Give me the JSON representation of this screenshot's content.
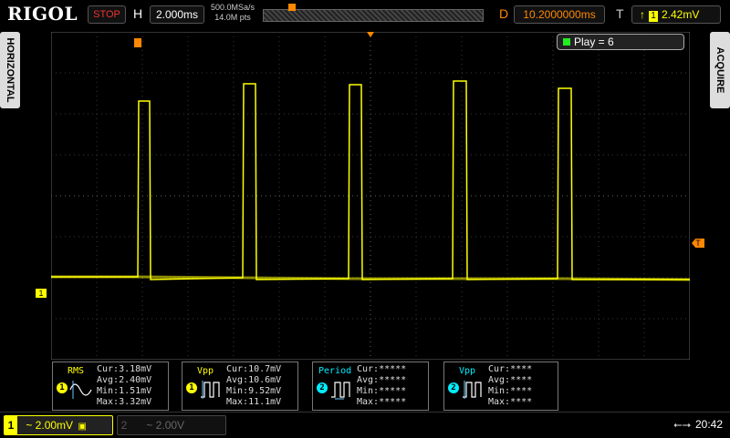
{
  "header": {
    "logo": "RIGOL",
    "run_state": "STOP",
    "horizontal_label": "H",
    "timebase": "2.000ms",
    "sample_rate": "500.0MSa/s",
    "memory_depth": "14.0M pts",
    "delay_label": "D",
    "delay": "10.2000000ms",
    "trigger_label": "T",
    "trigger_channel": "1",
    "trigger_level": "2.42mV"
  },
  "side_tabs": {
    "left": "HORIZONTAL",
    "right": "ACQUIRE"
  },
  "play_status": "Play = 6",
  "channel_marker": "1",
  "trigger_marker": "T",
  "measurements": [
    {
      "name": "RMS",
      "channel": "1",
      "cur": "Cur:3.18mV",
      "avg": "Avg:2.40mV",
      "min": "Min:1.51mV",
      "max": "Max:3.32mV",
      "color": "#ffff00"
    },
    {
      "name": "Vpp",
      "channel": "1",
      "cur": "Cur:10.7mV",
      "avg": "Avg:10.6mV",
      "min": "Min:9.52mV",
      "max": "Max:11.1mV",
      "color": "#ffff00"
    },
    {
      "name": "Period",
      "channel": "2",
      "cur": "Cur:*****",
      "avg": "Avg:*****",
      "min": "Min:*****",
      "max": "Max:*****",
      "color": "#00e5ff"
    },
    {
      "name": "Vpp",
      "channel": "2",
      "cur": "Cur:****",
      "avg": "Avg:****",
      "min": "Min:****",
      "max": "Max:****",
      "color": "#00e5ff"
    }
  ],
  "footer": {
    "ch1_number": "1",
    "ch1_scale": "~ 2.00mV",
    "ch2_number": "2",
    "ch2_scale": "~ 2.00V",
    "usb_icon": "usb-icon",
    "time": "20:42"
  },
  "colors": {
    "ch1": "#ffff00",
    "ch2": "#00e5ff",
    "accent": "#ff8800"
  }
}
